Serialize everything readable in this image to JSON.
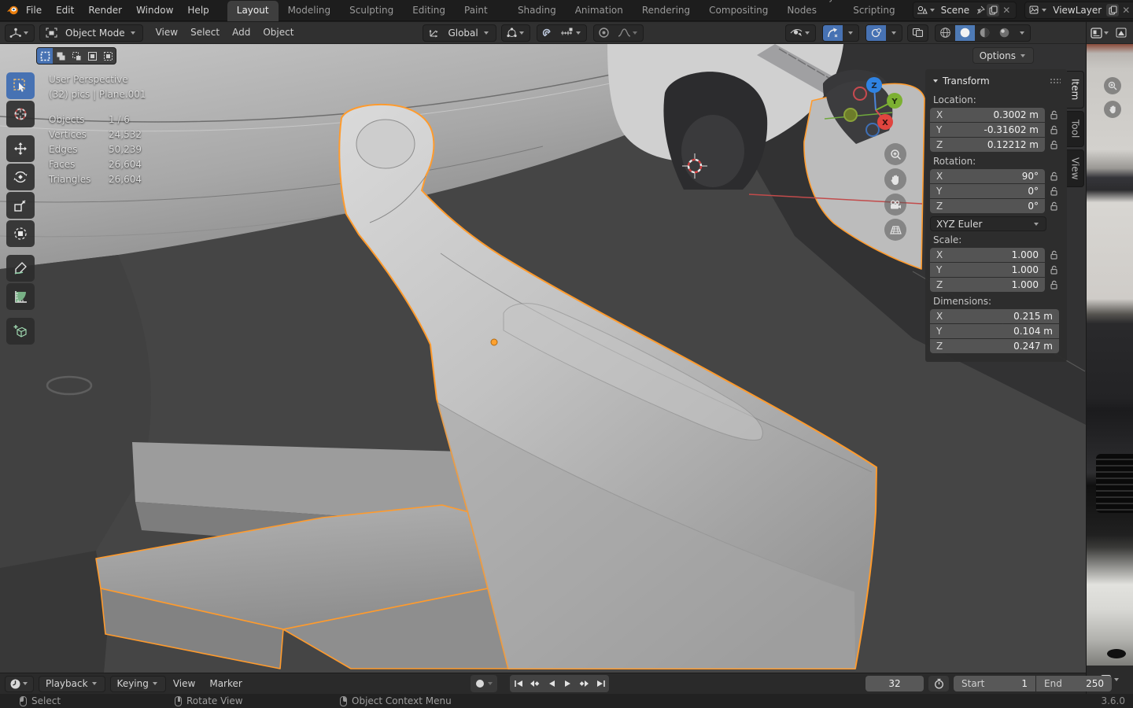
{
  "topbar": {
    "menus": [
      "File",
      "Edit",
      "Render",
      "Window",
      "Help"
    ],
    "workspaces": [
      "Layout",
      "Modeling",
      "Sculpting",
      "UV Editing",
      "Texture Paint",
      "Shading",
      "Animation",
      "Rendering",
      "Compositing",
      "Geometry Nodes",
      "Scripting"
    ],
    "active_workspace": "Layout",
    "scene_label": "Scene",
    "viewlayer_label": "ViewLayer"
  },
  "viewport_header": {
    "mode": "Object Mode",
    "menus": [
      "View",
      "Select",
      "Add",
      "Object"
    ],
    "orientation": "Global"
  },
  "tool_header": {
    "options_label": "Options"
  },
  "overlay": {
    "view_label": "User Perspective",
    "object_label": "(32) pics | Plane.001",
    "stats": [
      {
        "label": "Objects",
        "value": "1 / 6"
      },
      {
        "label": "Vertices",
        "value": "24,532"
      },
      {
        "label": "Edges",
        "value": "50,239"
      },
      {
        "label": "Faces",
        "value": "26,604"
      },
      {
        "label": "Triangles",
        "value": "26,604"
      }
    ]
  },
  "gizmo": {
    "x": "X",
    "y": "Y",
    "z": "Z"
  },
  "sidebar": {
    "tabs": [
      "Item",
      "Tool",
      "View"
    ],
    "active_tab": "Item",
    "panel_title": "Transform",
    "location": {
      "label": "Location:",
      "rows": [
        {
          "axis": "X",
          "value": "0.3002 m"
        },
        {
          "axis": "Y",
          "value": "-0.31602 m"
        },
        {
          "axis": "Z",
          "value": "0.12212 m"
        }
      ]
    },
    "rotation": {
      "label": "Rotation:",
      "rows": [
        {
          "axis": "X",
          "value": "90°"
        },
        {
          "axis": "Y",
          "value": "0°"
        },
        {
          "axis": "Z",
          "value": "0°"
        }
      ]
    },
    "rotation_mode": "XYZ Euler",
    "scale": {
      "label": "Scale:",
      "rows": [
        {
          "axis": "X",
          "value": "1.000"
        },
        {
          "axis": "Y",
          "value": "1.000"
        },
        {
          "axis": "Z",
          "value": "1.000"
        }
      ]
    },
    "dimensions": {
      "label": "Dimensions:",
      "rows": [
        {
          "axis": "X",
          "value": "0.215 m"
        },
        {
          "axis": "Y",
          "value": "0.104 m"
        },
        {
          "axis": "Z",
          "value": "0.247 m"
        }
      ]
    }
  },
  "timeline": {
    "menus": [
      "Playback",
      "Keying",
      "View",
      "Marker"
    ],
    "current_frame": "32",
    "start_label": "Start",
    "start_value": "1",
    "end_label": "End",
    "end_value": "250"
  },
  "statusbar": {
    "hints": [
      {
        "label": "Select"
      },
      {
        "label": "Rotate View"
      },
      {
        "label": "Object Context Menu"
      }
    ],
    "version": "3.6.0"
  },
  "colors": {
    "accent_blue": "#4772b3",
    "selection_orange": "#ff9b2d",
    "axis_x": "#e0453f",
    "axis_y": "#7cb032",
    "axis_z": "#2f83e3"
  }
}
